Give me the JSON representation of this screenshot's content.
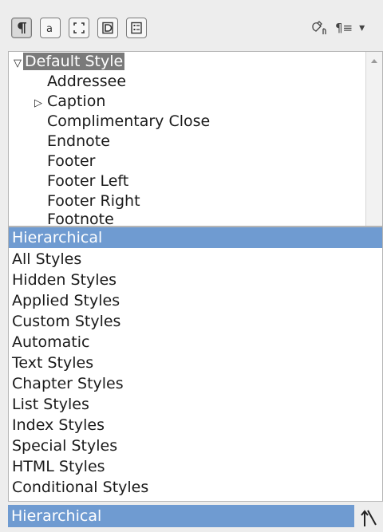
{
  "toolbar": {
    "buttons": [
      {
        "name": "paragraph-styles-icon",
        "glyph": "¶",
        "active": true
      },
      {
        "name": "character-styles-icon",
        "glyph": "a",
        "active": false
      },
      {
        "name": "frame-styles-icon",
        "glyph": "frame",
        "active": false
      },
      {
        "name": "page-styles-icon",
        "glyph": "D",
        "active": false
      },
      {
        "name": "list-styles-icon",
        "glyph": "list",
        "active": false
      }
    ],
    "fill_format_icon": "fill-format-mode-icon",
    "new_style_icon": "new-style-menu-icon",
    "new_style_glyph": "¶≡",
    "dropdown_glyph": "▾"
  },
  "tree": {
    "items": [
      {
        "label": "Default Style",
        "level": 0,
        "expander": "▽",
        "selected": true
      },
      {
        "label": "Addressee",
        "level": 1,
        "expander": "",
        "selected": false
      },
      {
        "label": "Caption",
        "level": 1,
        "expander": "▷",
        "selected": false
      },
      {
        "label": "Complimentary Close",
        "level": 1,
        "expander": "",
        "selected": false
      },
      {
        "label": "Endnote",
        "level": 1,
        "expander": "",
        "selected": false
      },
      {
        "label": "Footer",
        "level": 1,
        "expander": "",
        "selected": false
      },
      {
        "label": "Footer Left",
        "level": 1,
        "expander": "",
        "selected": false
      },
      {
        "label": "Footer Right",
        "level": 1,
        "expander": "",
        "selected": false
      },
      {
        "label": "Footnote",
        "level": 1,
        "expander": "",
        "selected": false
      }
    ]
  },
  "dropdown": {
    "options": [
      "Hierarchical",
      "All Styles",
      "Hidden Styles",
      "Applied Styles",
      "Custom Styles",
      "Automatic",
      "Text Styles",
      "Chapter Styles",
      "List Styles",
      "Index Styles",
      "Special Styles",
      "HTML Styles",
      "Conditional Styles"
    ],
    "highlighted": "Hierarchical"
  },
  "filter": {
    "selected": "Hierarchical",
    "button_icon": "show-previews-icon"
  },
  "colors": {
    "highlight": "#6f9bd1",
    "selected_tree": "#7a7a7a"
  }
}
